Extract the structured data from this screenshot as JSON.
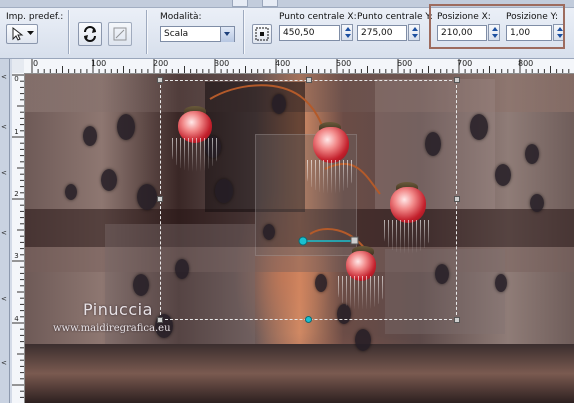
{
  "toolbar": {
    "preset_label": "Imp. predef.:",
    "mode": {
      "label": "Modalità:",
      "value": "Scala"
    },
    "center_x": {
      "label": "Punto centrale X:",
      "value": "450,50"
    },
    "center_y": {
      "label": "Punto centrale Y:",
      "value": "275,00"
    },
    "pos_x": {
      "label": "Posizione X:",
      "value": "210,00"
    },
    "pos_y": {
      "label": "Posizione Y:",
      "value": "1,00"
    },
    "highlight_color": "#9d6b5e"
  },
  "ruler_top": [
    "0",
    "100",
    "200",
    "300",
    "400",
    "500",
    "600",
    "700",
    "800"
  ],
  "ruler_left": [
    "0",
    "1",
    "2",
    "3",
    "4"
  ],
  "left_dock_marks": [
    "<",
    "<",
    "<",
    "<",
    "<",
    "<"
  ],
  "canvas": {
    "watermark_name": "Pinuccia",
    "watermark_url": "www.maidiregrafica.eu",
    "handle_color": "#19c0d0"
  }
}
